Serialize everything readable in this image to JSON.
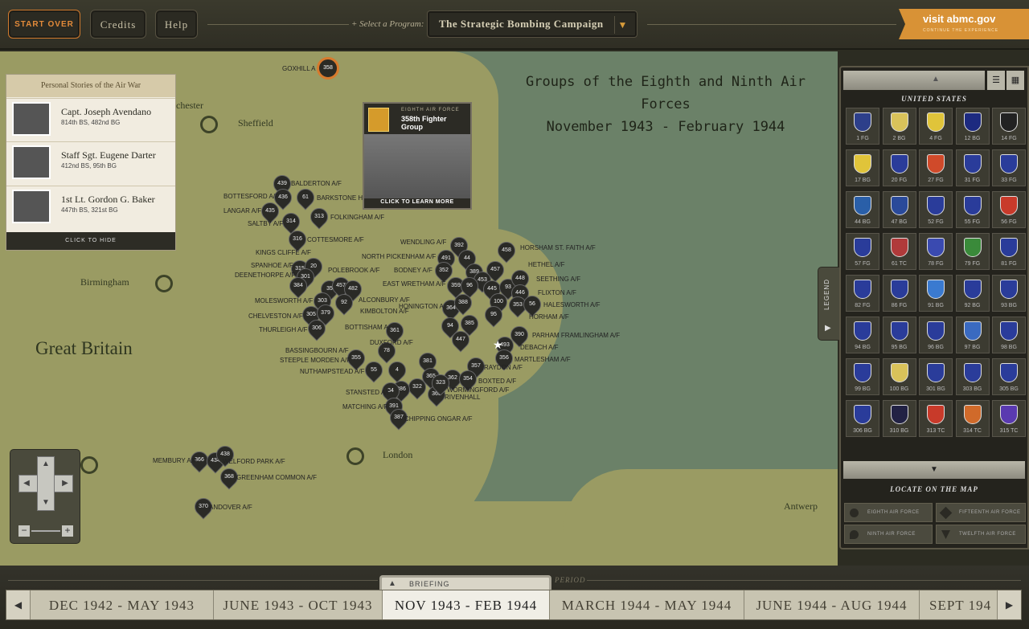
{
  "topbar": {
    "start_over": "START OVER",
    "credits": "Credits",
    "help": "Help",
    "select_label": "+ Select a Program:",
    "program": "The Strategic Bombing Campaign",
    "abmc_title": "visit abmc.gov",
    "abmc_sub": "CONTINUE THE EXPERIENCE"
  },
  "map": {
    "title_line1": "Groups of the Eighth and Ninth Air Forces",
    "title_line2": "November 1943 - February 1944",
    "places": [
      "Sheffield",
      "Birmingham",
      "Great Britain",
      "London",
      "Antwerp",
      "chester"
    ],
    "selected_pin": "358",
    "selected_label": "GOXHILL A",
    "pins": [
      "439",
      "436",
      "61",
      "435",
      "314",
      "313",
      "316",
      "315",
      "20",
      "301",
      "384",
      "35",
      "457",
      "482",
      "303",
      "92",
      "305",
      "379",
      "306",
      "491",
      "392",
      "44",
      "458",
      "352",
      "457",
      "389",
      "453",
      "359",
      "96",
      "445",
      "93",
      "448",
      "446",
      "100",
      "353",
      "56",
      "364",
      "388",
      "95",
      "94",
      "385",
      "390",
      "447",
      "493",
      "356",
      "361",
      "78",
      "355",
      "381",
      "4",
      "55",
      "357",
      "365",
      "363",
      "362",
      "323",
      "354",
      "322",
      "386",
      "34",
      "391",
      "387",
      "366",
      "434",
      "438",
      "368",
      "370"
    ],
    "airfields": [
      "BALDERTON A/F",
      "BOTTESFORD A/F",
      "BARKSTONE HE",
      "LANGAR A/F",
      "SALTBY A/F",
      "FOLKINGHAM A/F",
      "COTTESMORE A/F",
      "KINGS CLIFFE A/F",
      "SPANHOE A/F",
      "DEENETHORPE A/F",
      "POLEBROOK A/F",
      "MOLESWORTH A/F",
      "ALCONBURY A/F",
      "CHELVESTON A/F",
      "KIMBOLTON A/F",
      "THURLEIGH A/F",
      "BOTTISHAM A",
      "DUXFORD A/F",
      "BASSINGBOURN A/F",
      "STEEPLE MORDEN A/F",
      "NUTHAMPSTEAD A/F",
      "STANSTED A/F",
      "MATCHING A/F",
      "CHIPPING ONGAR A/F",
      "WENDLING A/F",
      "NORTH PICKENHAM A/F",
      "HORSHAM ST. FAITH A/F",
      "BODNEY A/F",
      "HETHEL A/F",
      "EAST WRETHAM A/F",
      "SEETHING A/F",
      "FLIXTON A/F",
      "HONINGTON A",
      "HALESWORTH A/F",
      "HORHAM A/F",
      "PARHAM FRAMLINGHAM A/F",
      "DEBACH A/F",
      "MARTLESHAM A/F",
      "RAYDON A/F",
      "BOXTED A/F",
      "WORMINGFORD A/F",
      "RIVENHALL",
      "MEMBURY A/F",
      "WELFORD PARK A/F",
      "GREENHAM COMMON A/F",
      "ANDOVER A/F"
    ]
  },
  "stories": {
    "title": "Personal Stories of the Air War",
    "items": [
      {
        "name": "Capt. Joseph Avendano",
        "unit": "814th BS, 482nd BG"
      },
      {
        "name": "Staff Sgt. Eugene Darter",
        "unit": "412nd BS, 95th BG"
      },
      {
        "name": "1st Lt. Gordon G. Baker",
        "unit": "447th BS, 321st BG"
      }
    ],
    "hide": "CLICK TO HIDE"
  },
  "popup": {
    "air_force": "EIGHTH AIR FORCE",
    "group": "358th Fighter Group",
    "learn": "CLICK TO LEARN MORE"
  },
  "panel": {
    "section": "UNITED STATES",
    "units": [
      "1 FG",
      "2 BG",
      "4 FG",
      "12 BG",
      "14 FG",
      "17 BG",
      "20 FG",
      "27 FG",
      "31 FG",
      "33 FG",
      "44 BG",
      "47 BG",
      "52 FG",
      "55 FG",
      "56 FG",
      "57 FG",
      "61 TC",
      "78 FG",
      "79 FG",
      "81 FG",
      "82 FG",
      "86 FG",
      "91 BG",
      "92 BG",
      "93 BG",
      "94 BG",
      "95 BG",
      "96 BG",
      "97 BG",
      "98 BG",
      "99 BG",
      "100 BG",
      "301 BG",
      "303 BG",
      "305 BG",
      "306 BG",
      "310 BG",
      "313 TC",
      "314 TC",
      "315 TC"
    ],
    "unit_colors": [
      "#2d3f8a",
      "#d9c25a",
      "#e0c43a",
      "#1d2a80",
      "#222222",
      "#e0c43a",
      "#2a3c9a",
      "#d04a2a",
      "#2a3c9a",
      "#2a3c9a",
      "#2a5fa8",
      "#2a4a9a",
      "#2a3c9a",
      "#2a3c9a",
      "#c83a2a",
      "#2a3c9a",
      "#b03a3a",
      "#3a4ab0",
      "#3a8a3a",
      "#2a3c9a",
      "#2a3c9a",
      "#2a3c9a",
      "#3a7ad0",
      "#2a3c9a",
      "#2a3c9a",
      "#2a3c9a",
      "#2a3c9a",
      "#2a3c9a",
      "#3a6ac0",
      "#2a3c9a",
      "#2a3c9a",
      "#d9c25a",
      "#2a3c9a",
      "#2a3c9a",
      "#2a3c9a",
      "#2a3c9a",
      "#222244",
      "#c83a2a",
      "#d06a2a",
      "#5a3ab0"
    ],
    "locate_title": "LOCATE ON THE MAP",
    "locate": [
      "EIGHTH AIR FORCE",
      "FIFTEENTH AIR FORCE",
      "NINTH AIR FORCE",
      "TWELFTH AIR FORCE"
    ],
    "legend": "LEGEND"
  },
  "timeline": {
    "briefing": "BRIEFING",
    "period_label": "PERIOD",
    "periods": [
      "DEC 1942 - MAY 1943",
      "JUNE 1943 - OCT 1943",
      "NOV 1943 - FEB 1944",
      "MARCH 1944 - MAY 1944",
      "JUNE 1944 - AUG 1944",
      "SEPT 194"
    ]
  }
}
